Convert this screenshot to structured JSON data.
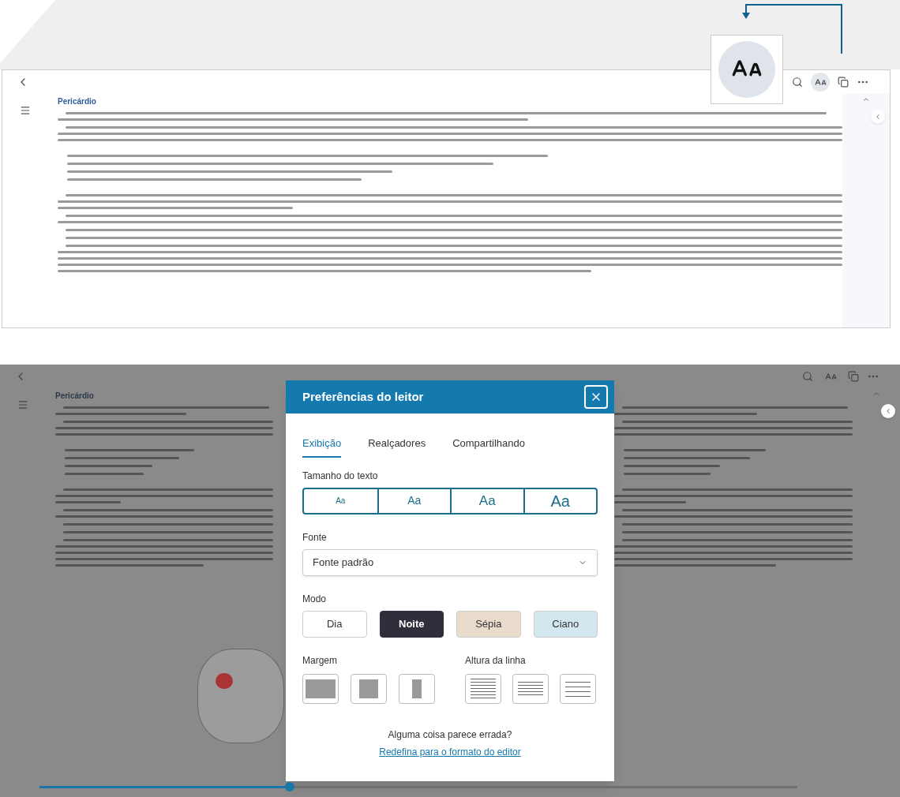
{
  "top_screenshot": {
    "heading": "Pericárdio"
  },
  "bottom_screenshot": {
    "heading": "Pericárdio",
    "progress": {
      "level": 0.33
    }
  },
  "dialog": {
    "title": "Preferências do leitor",
    "tabs": [
      {
        "label": "Exibição",
        "selected": true
      },
      {
        "label": "Realçadores",
        "selected": false
      },
      {
        "label": "Compartilhando",
        "selected": false
      }
    ],
    "text_size": {
      "label": "Tamanho do texto",
      "options": [
        {
          "label": "Aa",
          "kind": "xs"
        },
        {
          "label": "Aa",
          "kind": "sm"
        },
        {
          "label": "Aa",
          "kind": "md"
        },
        {
          "label": "Aa",
          "kind": "lg"
        }
      ]
    },
    "font": {
      "label": "Fonte",
      "value": "Fonte padrão"
    },
    "mode": {
      "label": "Modo",
      "options": [
        {
          "label": "Dia",
          "selected": false,
          "color": "#ffffff"
        },
        {
          "label": "Noite",
          "selected": true,
          "color": "#2f2e3b"
        },
        {
          "label": "Sépia",
          "selected": false,
          "color": "#eadccd"
        },
        {
          "label": "Ciano",
          "selected": false,
          "color": "#d3e8ee"
        }
      ]
    },
    "margin": {
      "label": "Margem",
      "options": [
        {
          "kind": "narrow"
        },
        {
          "kind": "medium"
        },
        {
          "kind": "wide"
        }
      ]
    },
    "line_height": {
      "label": "Altura da linha",
      "options": [
        {
          "kind": "tight"
        },
        {
          "kind": "normal"
        },
        {
          "kind": "loose"
        }
      ]
    },
    "footer": {
      "question": "Alguma coisa parece errada?",
      "link": "Redefina para o formato do editor"
    }
  }
}
